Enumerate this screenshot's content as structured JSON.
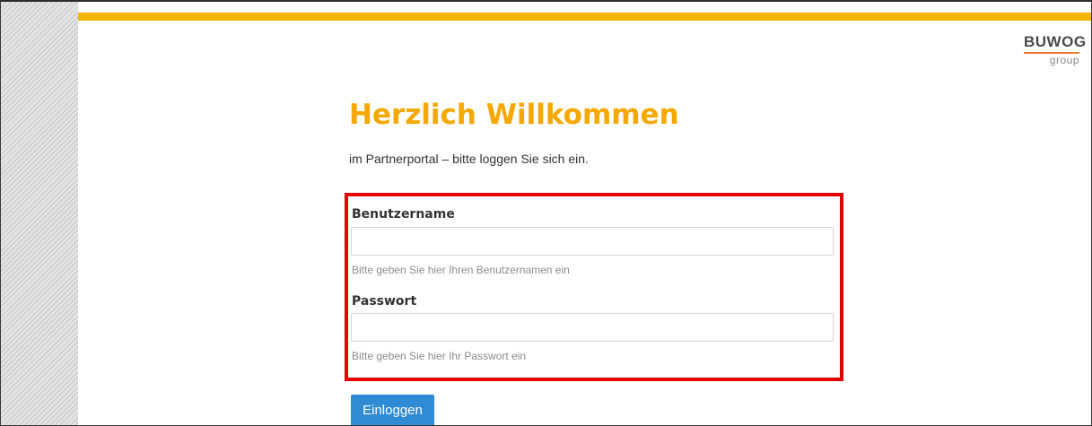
{
  "brand": {
    "logo_word": "BUWOG",
    "logo_sub": "group",
    "accent_color": "#f5b400",
    "logo_underline_color": "#ee7d2c"
  },
  "page": {
    "title": "Herzlich Willkommen",
    "subtitle": "im Partnerportal – bitte loggen Sie sich ein."
  },
  "form": {
    "username": {
      "label": "Benutzername",
      "value": "",
      "placeholder": "",
      "help": "Bitte geben Sie hier Ihren Benutzernamen ein"
    },
    "password": {
      "label": "Passwort",
      "value": "",
      "placeholder": "",
      "help": "Bitte geben Sie hier Ihr Passwort ein"
    },
    "submit_label": "Einloggen",
    "submit_color": "#2f8bd4",
    "highlight_color": "#e30000"
  }
}
